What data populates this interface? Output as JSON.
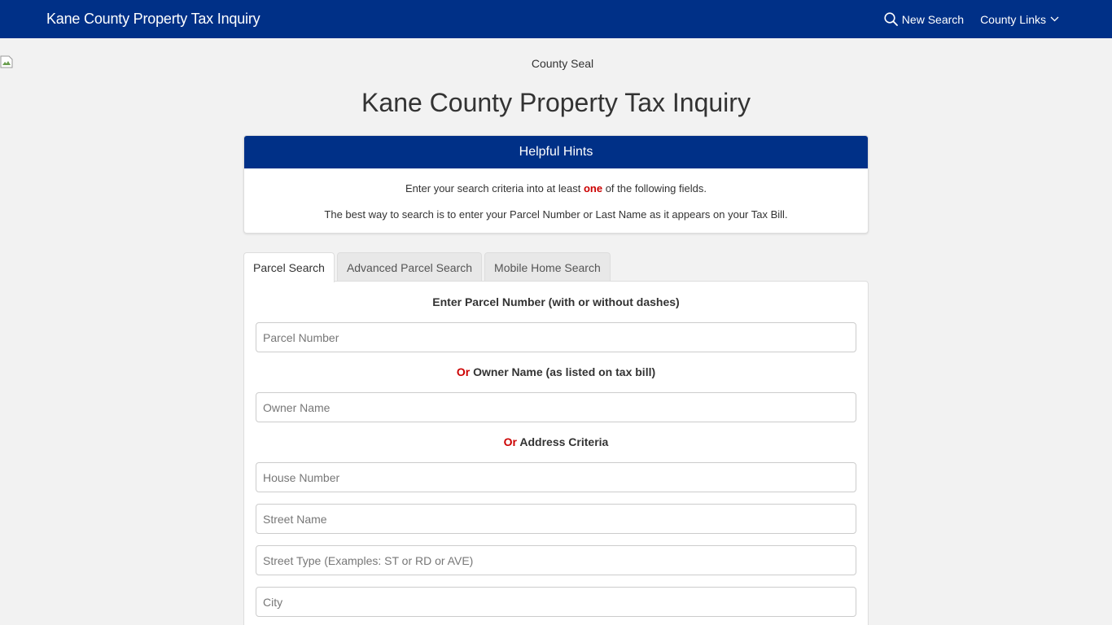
{
  "nav": {
    "brand": "Kane County Property Tax Inquiry",
    "new_search": "New Search",
    "county_links": "County Links",
    "bg_color": "#003087"
  },
  "seal_alt": "County Seal",
  "page_title": "Kane County Property Tax Inquiry",
  "hints": {
    "title": "Helpful Hints",
    "line1_before": "Enter your search criteria into at least ",
    "line1_highlight": "one",
    "line1_after": " of the following fields.",
    "line2": "The best way to search is to enter your Parcel Number or Last Name as it appears on your Tax Bill."
  },
  "tabs": [
    {
      "label": "Parcel Search",
      "active": true
    },
    {
      "label": "Advanced Parcel Search",
      "active": false
    },
    {
      "label": "Mobile Home Search",
      "active": false
    }
  ],
  "form": {
    "parcel_label": "Enter Parcel Number (with or without dashes)",
    "parcel_placeholder": "Parcel Number",
    "or_word": "Or",
    "owner_label": " Owner Name (as listed on tax bill)",
    "owner_placeholder": "Owner Name",
    "address_label": " Address Criteria",
    "house_placeholder": "House Number",
    "street_placeholder": "Street Name",
    "street_type_placeholder": "Street Type (Examples: ST or RD or AVE)",
    "city_placeholder": "City"
  }
}
